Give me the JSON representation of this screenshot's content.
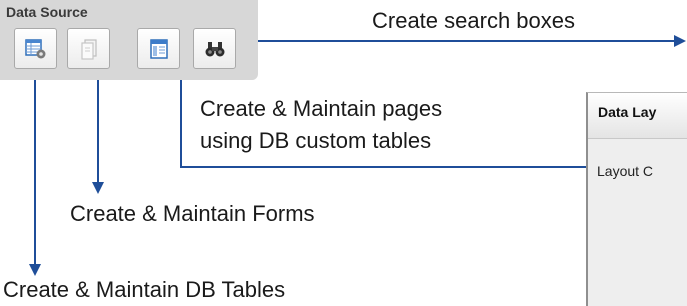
{
  "toolbar": {
    "group_title": "Data Source",
    "buttons": [
      {
        "icon": "table-settings-icon"
      },
      {
        "icon": "form-icon"
      },
      {
        "icon": "page-layout-icon"
      },
      {
        "icon": "binoculars-icon"
      }
    ]
  },
  "annotations": {
    "search": "Create search boxes",
    "pages_line1": "Create & Maintain pages",
    "pages_line2": "using DB custom tables",
    "forms": "Create & Maintain Forms",
    "tables": "Create & Maintain DB Tables"
  },
  "panel": {
    "header": "Data Lay",
    "field": "Layout C"
  },
  "colors": {
    "arrow": "#1f4e99",
    "toolbar_bg": "#d7d7d7",
    "panel_bg": "#eeeeee"
  }
}
